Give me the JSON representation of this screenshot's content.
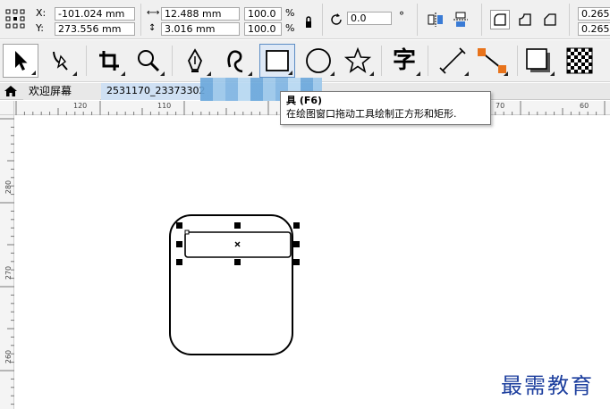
{
  "propbar": {
    "x_label": "X:",
    "y_label": "Y:",
    "x_value": "-101.024 mm",
    "y_value": "273.556 mm",
    "width_value": "12.488 mm",
    "height_value": "3.016 mm",
    "scale_x": "100.0",
    "scale_y": "100.0",
    "percent": "%",
    "rotation": "0.0",
    "degree": "°",
    "corner_1": "0.265",
    "corner_2": "0.265"
  },
  "tabs": {
    "welcome": "欢迎屏幕",
    "document": "2531170_23373302"
  },
  "tooltip": {
    "title": "具 (F6)",
    "description": "在绘图窗口拖动工具绘制正方形和矩形."
  },
  "ruler": {
    "h_labels": [
      "120",
      "110",
      "70",
      "60"
    ],
    "v_labels": [
      "280",
      "270",
      "260"
    ]
  },
  "watermark": "最需教育"
}
